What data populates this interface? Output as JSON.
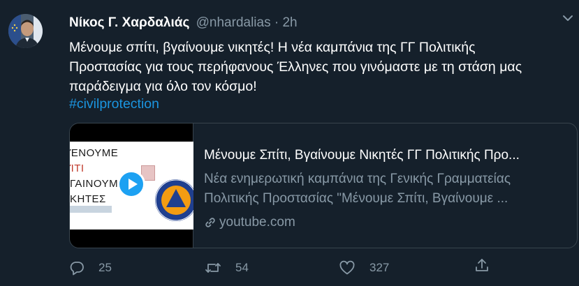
{
  "author": {
    "name": "Νίκος Γ. Χαρδαλιάς",
    "handle": "@nhardalias",
    "separator": "·",
    "time": "2h"
  },
  "tweet": {
    "text": "Μένουμε σπίτι, βγαίνουμε νικητές! Η νέα καμπάνια της ΓΓ Πολιτικής\nΠροστασίας για τους περήφανους Έλληνες που γινόμαστε με τη στάση μας\nπαράδειγμα για όλο τον κόσμο!",
    "hashtag": "#civilprotection"
  },
  "card": {
    "title": "Μένουμε Σπίτι, Βγαίνουμε Νικητές ΓΓ Πολιτικής Προ...",
    "description_line1": "Νέα ενημερωτική καμπάνια της Γενικής Γραμματείας",
    "description_line2": "Πολιτικής Προστασίας \"Μένουμε Σπίτι, Βγαίνουμε ...",
    "domain": "youtube.com",
    "thumbnail": {
      "line1": "ΈΝΟΥΜΕ",
      "line2": "ΊΤΙ",
      "line3": "ΓΑΙΝΟΥΜ",
      "line4": "ΚΗΤΕΣ",
      "play_icon": "play-icon",
      "accent": "#1da1f2"
    }
  },
  "actions": {
    "reply_count": "25",
    "retweet_count": "54",
    "like_count": "327"
  },
  "colors": {
    "background": "#15202b",
    "secondary_text": "#8899a6",
    "link": "#1b95e0",
    "border": "#38444d"
  }
}
